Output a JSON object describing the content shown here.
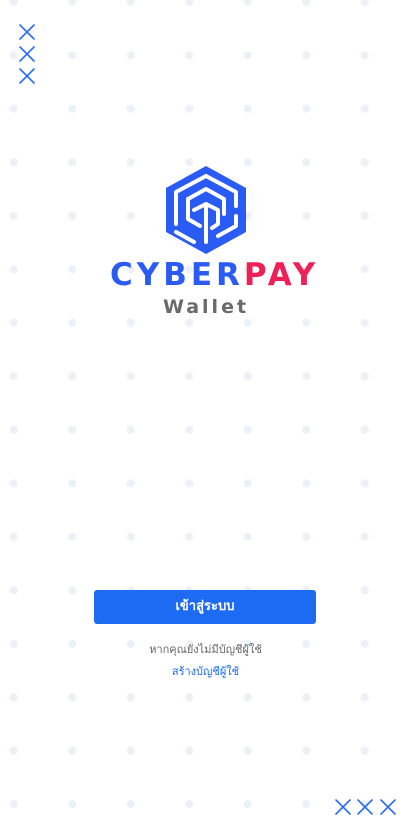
{
  "brand": {
    "name_part1": "CYBER",
    "name_part2": "PAY",
    "subtitle": "Wallet",
    "logo_icon": "cube-maze-logo-icon"
  },
  "actions": {
    "login_label": "เข้าสู่ระบบ",
    "no_account_text": "หากคุณยังไม่มีบัญชีผู้ใช้",
    "register_label": "สร้างบัญชีผู้ใช้"
  },
  "decor": {
    "top_left_icon": "x-marks-icon",
    "bottom_right_icon": "x-marks-icon"
  },
  "colors": {
    "primary": "#1c6bf2",
    "brand_blue": "#2a5bf4",
    "brand_pink": "#ef1f58",
    "subtitle_gray": "#6a6a6a",
    "background": "#ffffff",
    "dot": "#eef0f7"
  }
}
